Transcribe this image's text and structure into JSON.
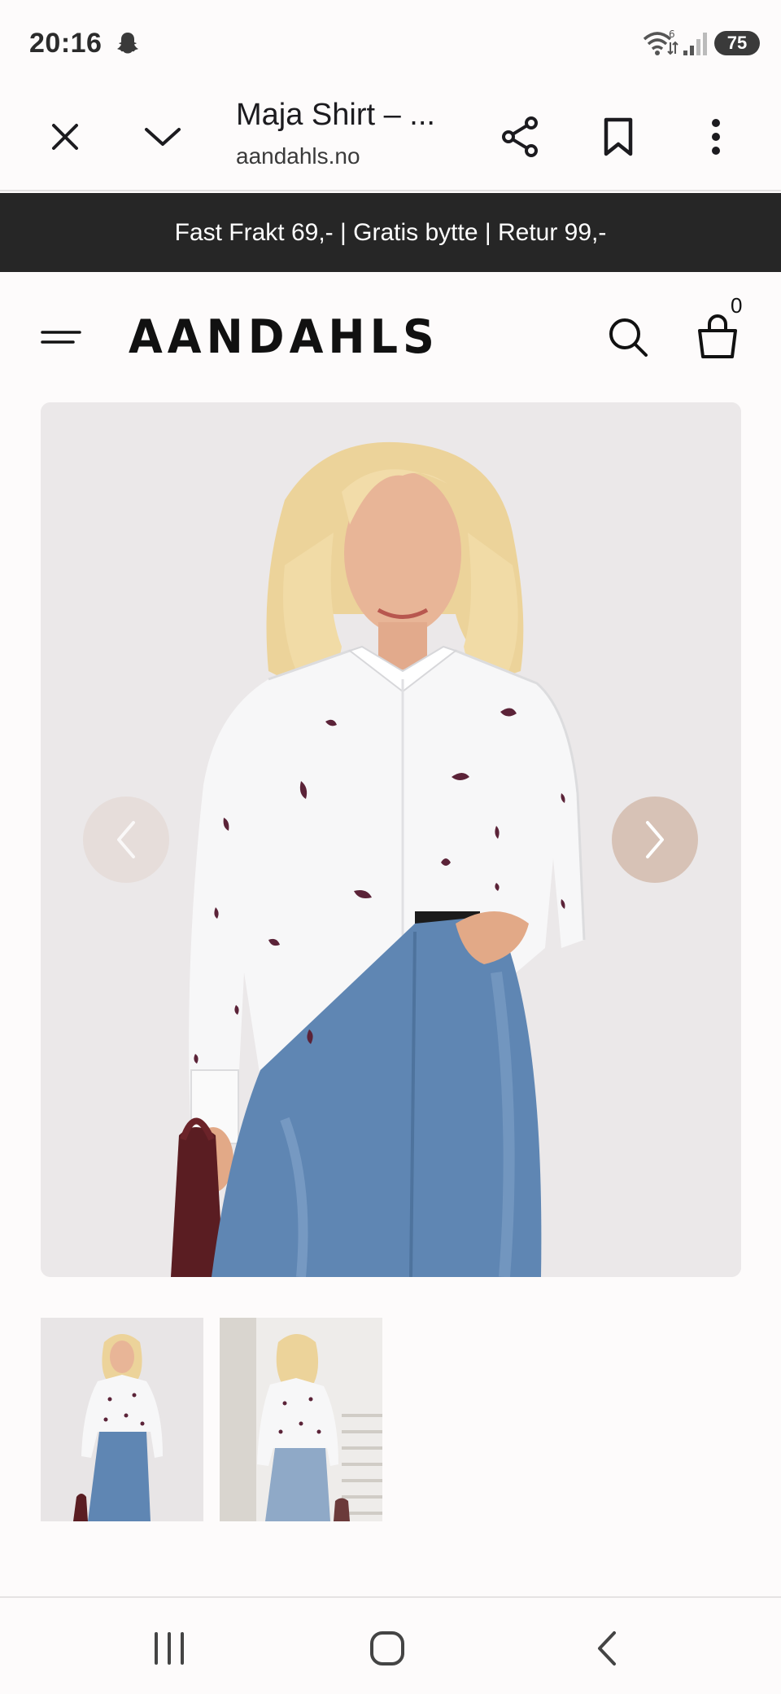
{
  "status_bar": {
    "time": "20:16",
    "battery": "75",
    "icons": [
      "snapchat-icon",
      "wifi-icon",
      "signal-icon",
      "battery-icon"
    ]
  },
  "browser": {
    "title": "Maja Shirt – ...",
    "url": "aandahls.no",
    "icons": [
      "close-icon",
      "chevron-down-icon",
      "share-icon",
      "bookmark-icon",
      "more-vert-icon"
    ]
  },
  "announcement": {
    "text": "Fast Frakt 69,- | Gratis bytte | Retur 99,-"
  },
  "site_header": {
    "logo": "AANDAHLS",
    "cart_count": "0",
    "icons": [
      "hamburger-menu-icon",
      "search-icon",
      "shopping-bag-icon"
    ]
  },
  "gallery": {
    "images": [
      "product-photo-front",
      "product-photo-back"
    ],
    "icons": [
      "chevron-left-icon",
      "chevron-right-icon"
    ]
  },
  "colors": {
    "announcement_bg": "#262626",
    "gallery_bg": "#ebe8e9",
    "next_button": "#d7c2b6",
    "shirt_embroidery": "#5b2338",
    "jeans": "#5f86b3"
  },
  "system_nav": {
    "icons": [
      "recent-apps-icon",
      "home-icon",
      "back-icon"
    ]
  }
}
